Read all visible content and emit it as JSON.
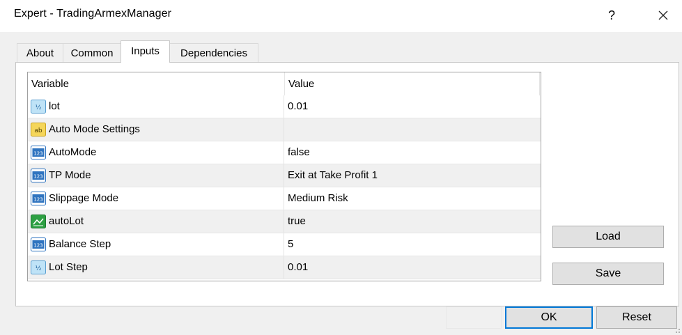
{
  "window": {
    "title": "Expert - TradingArmexManager",
    "help_label": "?",
    "close_icon": "close-icon"
  },
  "tabs": [
    {
      "label": "About",
      "active": false
    },
    {
      "label": "Common",
      "active": false
    },
    {
      "label": "Inputs",
      "active": true
    },
    {
      "label": "Dependencies",
      "active": false
    }
  ],
  "grid": {
    "columns": [
      "Variable",
      "Value"
    ],
    "rows": [
      {
        "icon": "double-type-icon",
        "variable": "lot",
        "value": "0.01"
      },
      {
        "icon": "string-type-icon",
        "variable": "Auto Mode Settings",
        "value": ""
      },
      {
        "icon": "integer-type-icon",
        "variable": "AutoMode",
        "value": "false"
      },
      {
        "icon": "integer-type-icon",
        "variable": "TP Mode",
        "value": "Exit at Take Profit 1"
      },
      {
        "icon": "integer-type-icon",
        "variable": "Slippage Mode",
        "value": "Medium Risk"
      },
      {
        "icon": "bool-type-icon",
        "variable": "autoLot",
        "value": "true"
      },
      {
        "icon": "integer-type-icon",
        "variable": "Balance Step",
        "value": "5"
      },
      {
        "icon": "double-type-icon",
        "variable": "Lot Step",
        "value": "0.01"
      }
    ]
  },
  "buttons": {
    "load": "Load",
    "save": "Save",
    "ok": "OK",
    "reset": "Reset"
  },
  "colors": {
    "double_icon_bg": "#bfe3f7",
    "string_icon_bg": "#f5d65a",
    "integer_icon_bg": "#2f74c0",
    "bool_icon_bg": "#2ea043",
    "focus_border": "#0078d7"
  }
}
